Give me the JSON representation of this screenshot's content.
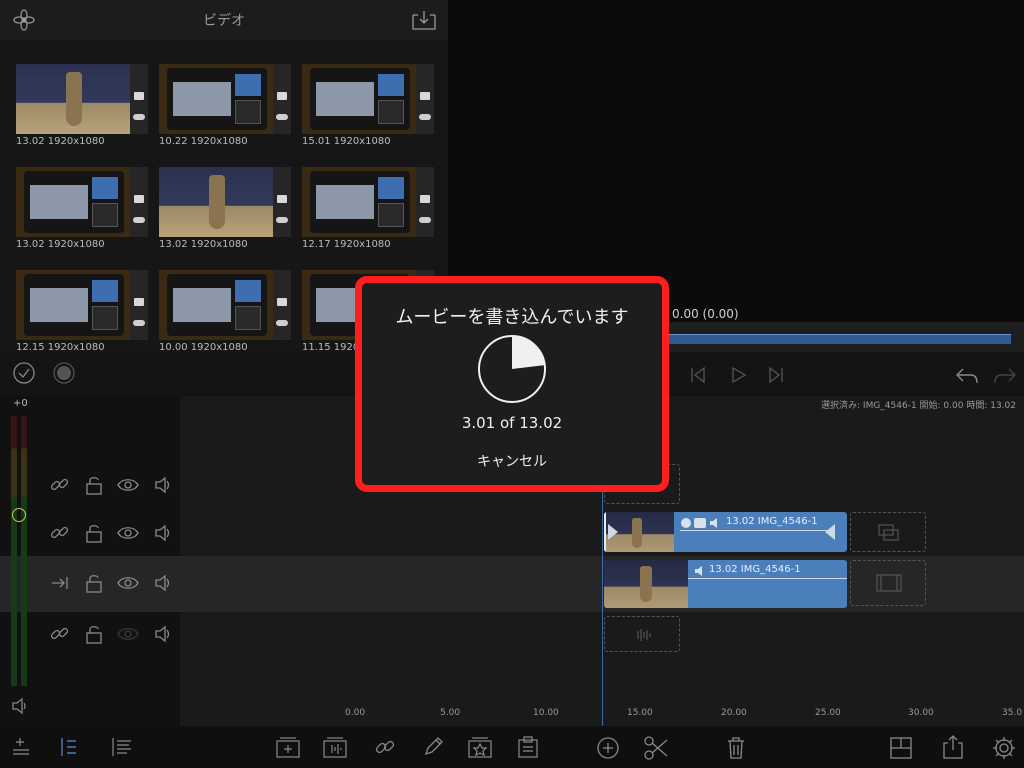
{
  "browser": {
    "title": "ビデオ",
    "thumbnails": [
      {
        "caption": "13.02  1920x1080",
        "kind": "statue"
      },
      {
        "caption": "10.22  1920x1080",
        "kind": "screen"
      },
      {
        "caption": "15.01  1920x1080",
        "kind": "screen"
      },
      {
        "caption": "13.02  1920x1080",
        "kind": "screen"
      },
      {
        "caption": "13.02  1920x1080",
        "kind": "statue"
      },
      {
        "caption": "12.17  1920x1080",
        "kind": "screen"
      },
      {
        "caption": "12.15  1920x1080",
        "kind": "screen"
      },
      {
        "caption": "10.00  1920x1080",
        "kind": "screen"
      },
      {
        "caption": "11.15  1920x1080",
        "kind": "screen"
      }
    ]
  },
  "viewer": {
    "time_readout": "0.00  (0.00)"
  },
  "timeline": {
    "meter_label": "+0",
    "selection_info": "選択済み: IMG_4546-1 開始: 0.00 時間: 13.02",
    "clip_video_label": "13.02  IMG_4546-1",
    "clip_audio_label": "13.02  IMG_4546-1",
    "ruler": [
      "0.00",
      "5.00",
      "10.00",
      "15.00",
      "20.00",
      "25.00",
      "30.00",
      "35.0"
    ]
  },
  "modal": {
    "title": "ムービーを書き込んでいます",
    "progress_text": "3.01 of 13.02",
    "progress_fraction": 0.231,
    "cancel_label": "キャンセル"
  },
  "colors": {
    "accent_blue": "#4a7fbc",
    "modal_highlight": "#ff1e1e"
  }
}
